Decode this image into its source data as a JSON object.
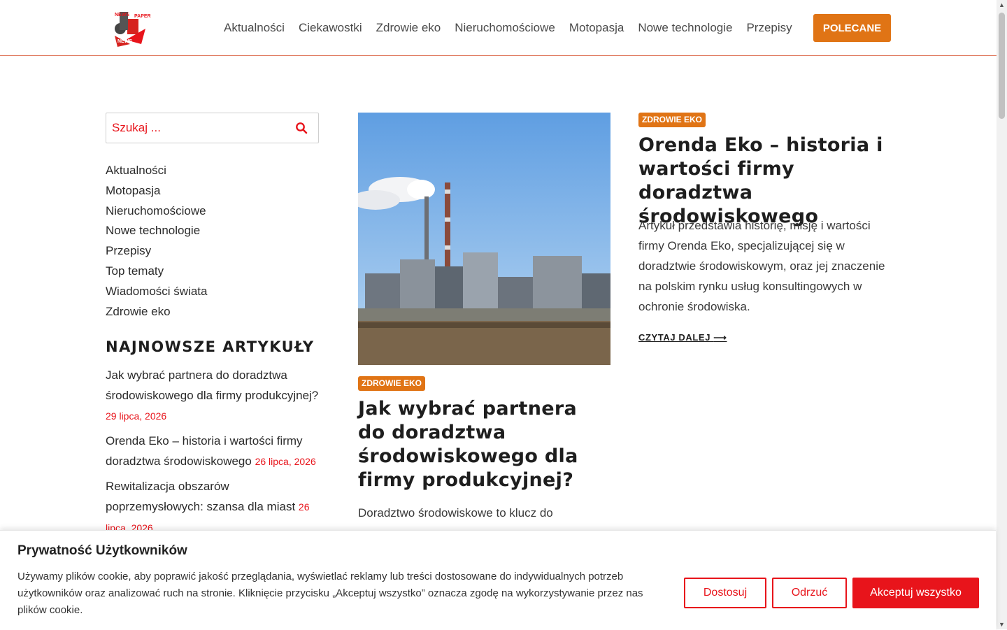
{
  "nav": {
    "items": [
      "Aktualności",
      "Ciekawostki",
      "Zdrowie eko",
      "Nieruchomościowe",
      "Motopasja",
      "Nowe technologie",
      "Przepisy"
    ],
    "cta": "POLECANE"
  },
  "logo": {
    "text_top": "NEWS",
    "text_right": "PAPER",
    "text_bottom": "NEWS"
  },
  "search": {
    "placeholder": "Szukaj ..."
  },
  "sidebar": {
    "categories": [
      "Aktualności",
      "Motopasja",
      "Nieruchomościowe",
      "Nowe technologie",
      "Przepisy",
      "Top tematy",
      "Wiadomości świata",
      "Zdrowie eko"
    ],
    "recent_heading": "NAJNOWSZE ARTYKUŁY",
    "recent": [
      {
        "title": "Jak wybrać partnera do doradztwa środowiskowego dla firmy produkcyjnej?",
        "date": "29 lipca, 2026"
      },
      {
        "title": "Orenda Eko – historia i wartości firmy doradztwa środowiskowego",
        "date": "26 lipca, 2026"
      },
      {
        "title": "Rewitalizacja obszarów poprzemysłowych: szansa dla miast",
        "date": "26 lipca, 2026"
      }
    ]
  },
  "articles": [
    {
      "category": "ZDROWIE EKO",
      "title": "Jak wybrać partnera do doradztwa środowiskowego dla firmy produkcyjnej?",
      "excerpt": "Doradztwo środowiskowe to klucz do"
    },
    {
      "category": "ZDROWIE EKO",
      "title": "Orenda Eko – historia i wartości firmy doradztwa środowiskowego",
      "excerpt": "Artykuł przedstawia historię, misję i wartości firmy Orenda Eko, specjalizującej się w doradztwie środowiskowym, oraz jej znaczenie na polskim rynku usług konsultingowych w ochronie środowiska.",
      "read_more": "CZYTAJ DALEJ"
    }
  ],
  "cookie": {
    "title": "Prywatność Użytkowników",
    "text": "Używamy plików cookie, aby poprawić jakość przeglądania, wyświetlać reklamy lub treści dostosowane do indywidualnych potrzeb użytkowników oraz analizować ruch na stronie. Kliknięcie przycisku „Akceptuj wszystko” oznacza zgodę na wykorzystywanie przez nas plików cookie.",
    "customize": "Dostosuj",
    "reject": "Odrzuć",
    "accept": "Akceptuj wszystko"
  },
  "colors": {
    "accent": "#e07415",
    "brand_red": "#e8141b"
  }
}
